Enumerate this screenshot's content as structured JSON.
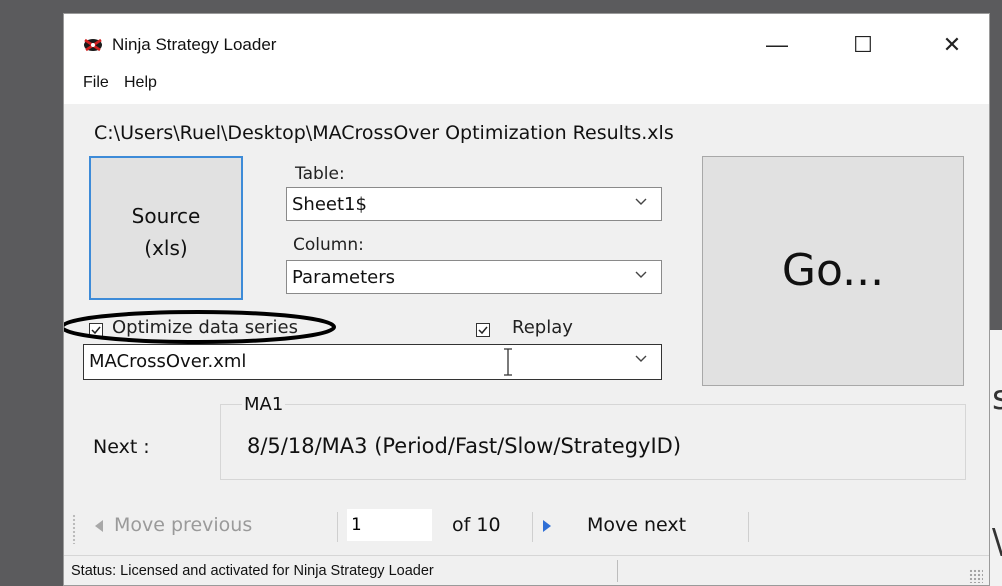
{
  "window": {
    "title": "Ninja Strategy Loader",
    "controls": {
      "minimize": "—",
      "maximize": "☐",
      "close": "✕"
    }
  },
  "menu": {
    "file": "File",
    "help": "Help"
  },
  "file_path": "C:\\Users\\Ruel\\Desktop\\MACrossOver Optimization Results.xls",
  "source_button": {
    "line1": "Source",
    "line2": "(xls)"
  },
  "table": {
    "label": "Table:",
    "value": "Sheet1$"
  },
  "column": {
    "label": "Column:",
    "value": "Parameters"
  },
  "go_button": {
    "label": "Go..."
  },
  "options": {
    "optimize": {
      "label": "Optimize data series",
      "checked": true
    },
    "replay": {
      "label": "Replay",
      "checked": true
    }
  },
  "strategy_file": {
    "value": "MACrossOver.xml"
  },
  "parameter_group": {
    "legend": "MA1",
    "next_label": "Next :",
    "next_value": "8/5/18/MA3 (Period/Fast/Slow/StrategyID)"
  },
  "navigation": {
    "prev_label": "Move previous",
    "page": "1",
    "of_label": "of 10",
    "next_label": "Move next"
  },
  "status": {
    "text": "Status:  Licensed and activated for Ninja Strategy Loader"
  },
  "colors": {
    "source_border": "#3d8bd8",
    "nav_arrow_active": "#2f6fd6",
    "nav_arrow_disabled": "#a8a8a8",
    "annotation": "#000000"
  },
  "icons": {
    "app": "ninja-star-icon",
    "combo": "chevron-down-icon",
    "checkbox": "checkmark-icon",
    "prev": "triangle-left-icon",
    "next": "triangle-right-icon"
  }
}
